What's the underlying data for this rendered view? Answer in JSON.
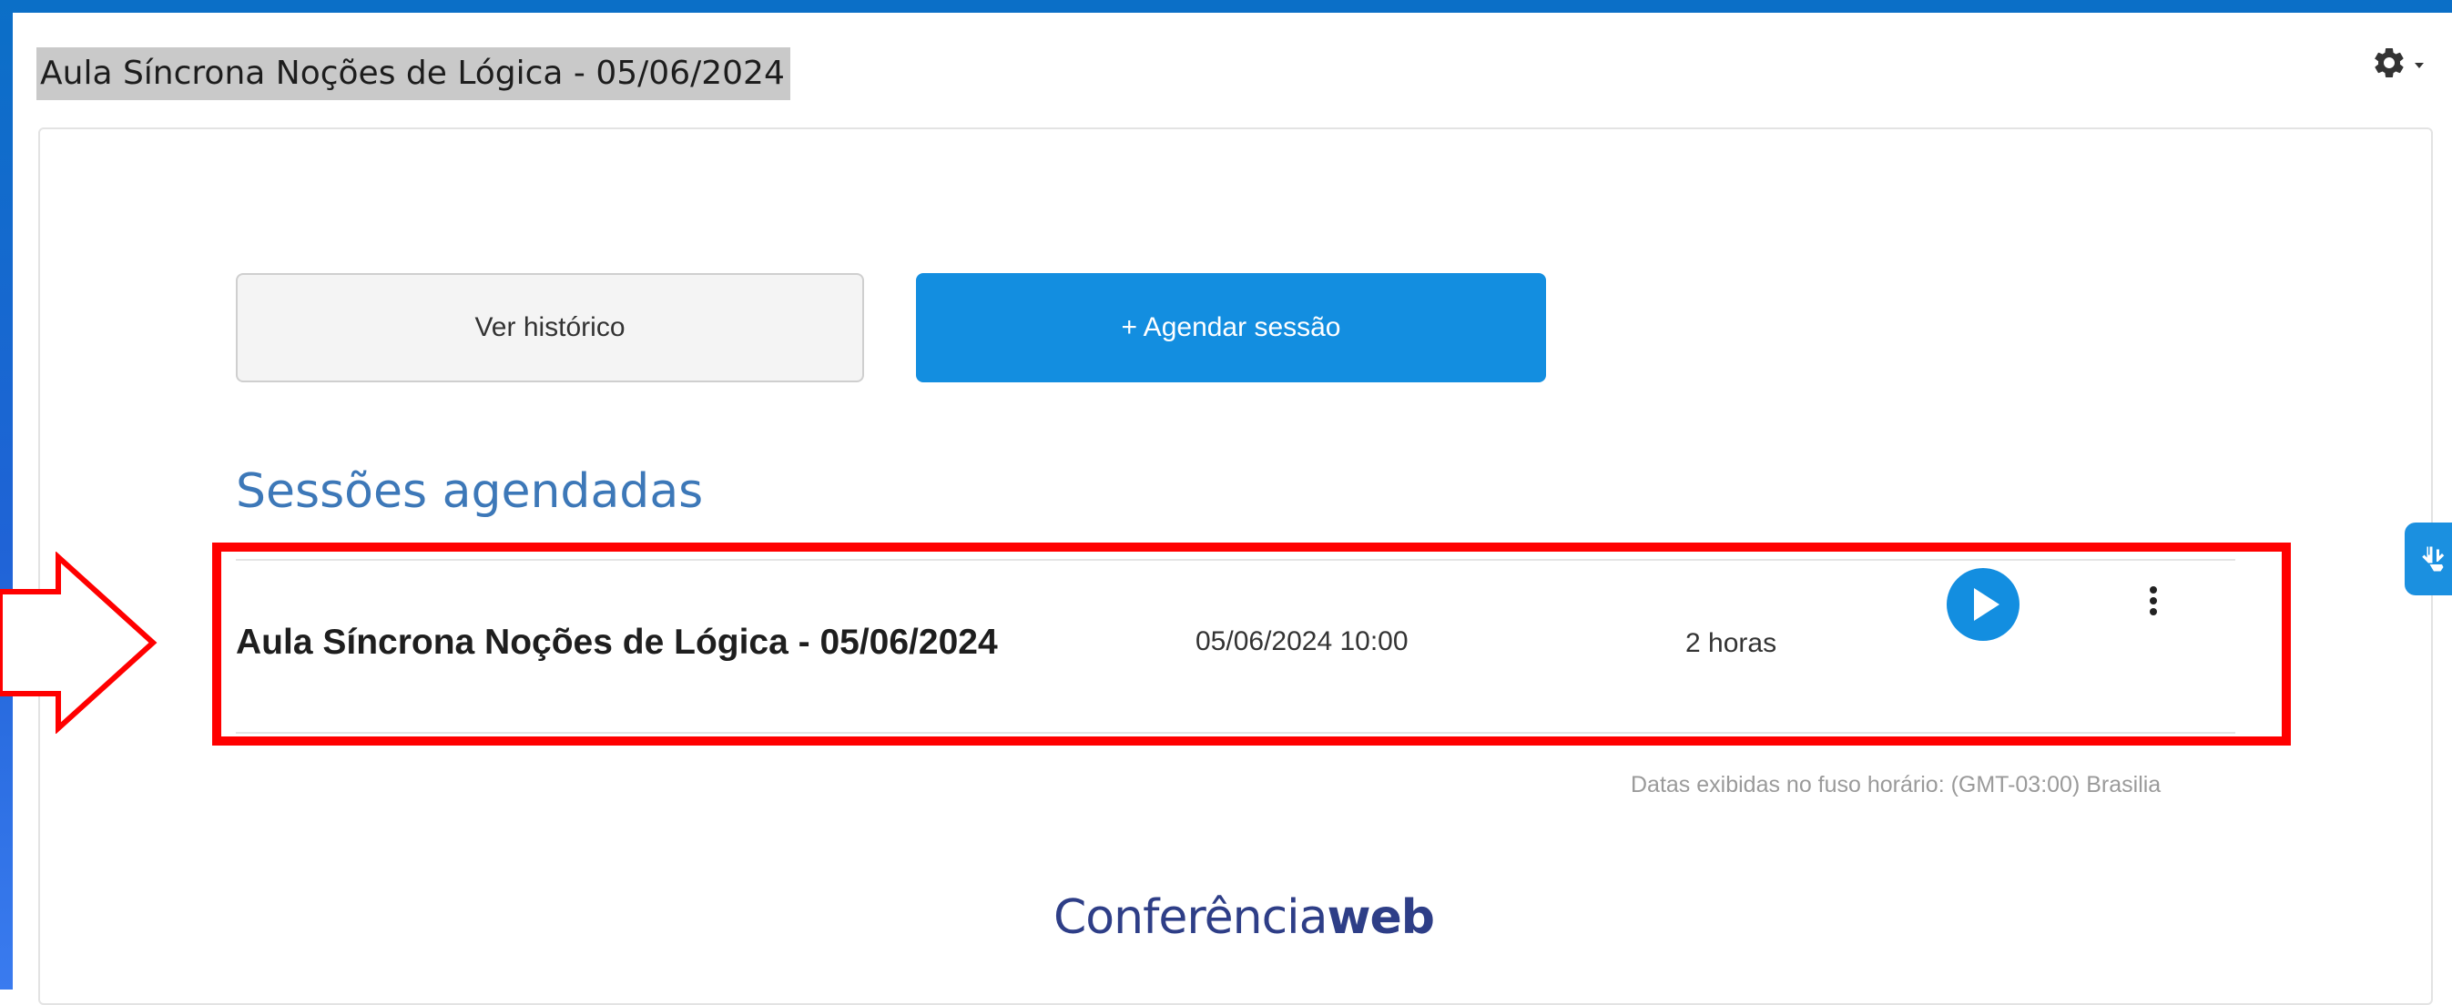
{
  "page": {
    "title": "Aula Síncrona Noções de Lógica - 05/06/2024"
  },
  "toolbar": {
    "settings_icon": "gear-icon"
  },
  "actions": {
    "history_label": "Ver histórico",
    "schedule_label": "+ Agendar sessão"
  },
  "sessions": {
    "heading": "Sessões agendadas",
    "items": [
      {
        "name": "Aula Síncrona Noções de Lógica - 05/06/2024",
        "datetime": "05/06/2024 10:00",
        "duration": "2 horas",
        "play_icon": "play-icon",
        "menu_icon": "kebab-menu-icon"
      }
    ],
    "timezone_note": "Datas exibidas no fuso horário: (GMT-03:00) Brasilia"
  },
  "brand": {
    "logo_light": "Conferência",
    "logo_bold": "web",
    "color": "#2e3e87"
  },
  "colors": {
    "primary": "#138ee0",
    "heading": "#3d78b8",
    "annotation": "#ff0000",
    "frame": "#0b6fc7"
  },
  "annotations": {
    "arrow_icon": "red-arrow-icon",
    "highlight": "red-highlight-box"
  },
  "accessibility": {
    "icon": "sign-language-hands-icon"
  }
}
